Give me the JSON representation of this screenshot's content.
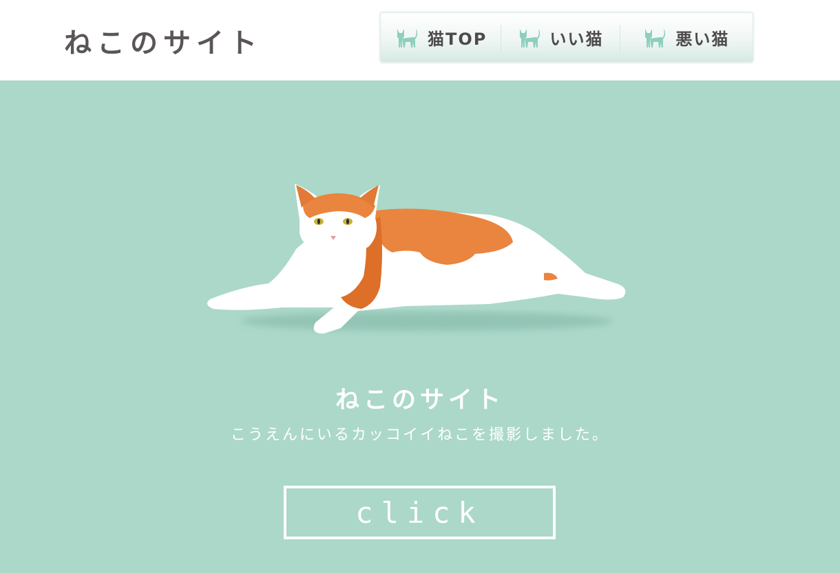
{
  "header": {
    "logo": "ねこのサイト",
    "nav": [
      {
        "label": "猫TOP",
        "icon": "cat-icon"
      },
      {
        "label": "いい猫",
        "icon": "cat-icon"
      },
      {
        "label": "悪い猫",
        "icon": "cat-icon"
      }
    ]
  },
  "hero": {
    "title": "ねこのサイト",
    "subtitle": "こうえんにいるカッコイイねこを撮影しました。",
    "button_label": "click",
    "image": "orange-white-cat-photo"
  },
  "colors": {
    "hero_bg": "#abd8c9",
    "text_dark": "#5b5656",
    "icon": "#8ecfbd",
    "white": "#ffffff"
  }
}
